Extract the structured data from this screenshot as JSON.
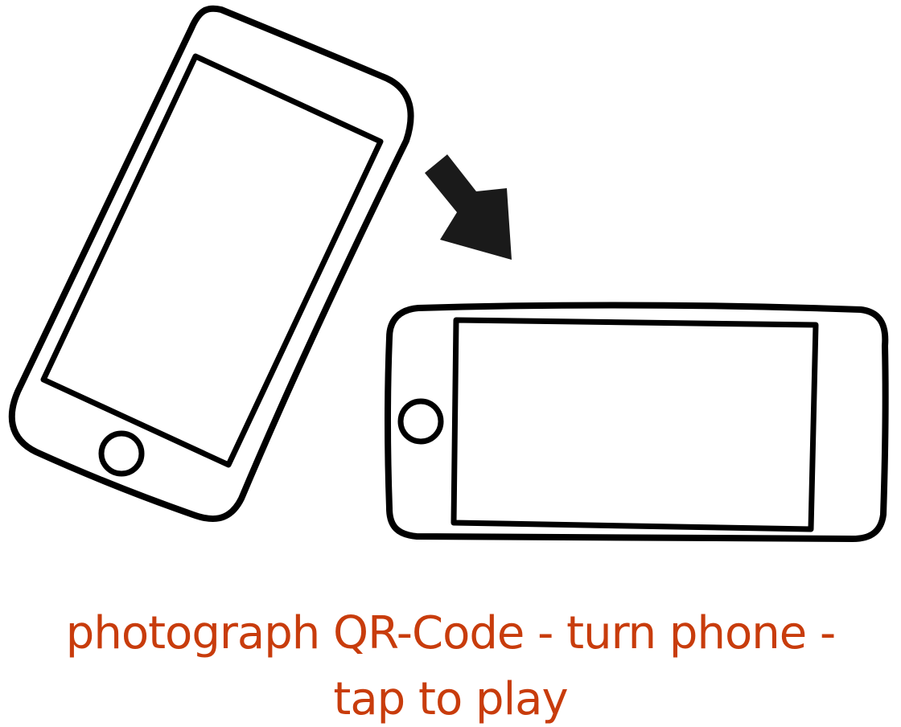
{
  "instruction": {
    "line1": "photograph QR-Code - turn phone -",
    "line2": "tap to play"
  },
  "colors": {
    "text": "#c83c0c",
    "stroke": "#000000",
    "background": "#ffffff"
  },
  "icons": [
    "phone-portrait-tilted-icon",
    "arrow-down-right-icon",
    "phone-landscape-icon"
  ]
}
